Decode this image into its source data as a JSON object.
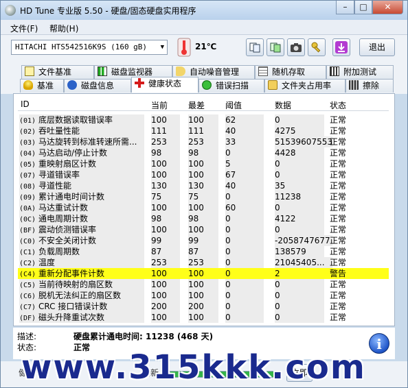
{
  "window": {
    "title": "HD Tune 专业版 5.50 - 硬盘/固态硬盘实用程序",
    "buttons": {
      "minimize": "–",
      "maximize": "□",
      "close": "✕"
    }
  },
  "menu": [
    "文件(F)",
    "帮助(H)"
  ],
  "toolbar": {
    "drive": "HITACHI HTS542516K9S (160 gB)",
    "temperature": "21℃",
    "exit_label": "退出",
    "icons": [
      "copy-text-icon",
      "copy-screen-icon",
      "camera-icon",
      "options-key-icon",
      "save-download-icon"
    ]
  },
  "tabs_top": [
    {
      "label": "文件基准",
      "icon": "benchmark-file-icon"
    },
    {
      "label": "磁盘监视器",
      "icon": "disk-monitor-icon"
    },
    {
      "label": "自动噪音管理",
      "icon": "speaker-icon"
    },
    {
      "label": "随机存取",
      "icon": "random-access-icon"
    },
    {
      "label": "附加测试",
      "icon": "extra-tests-icon"
    }
  ],
  "tabs_bottom": [
    {
      "label": "基准",
      "icon": "bulb-icon"
    },
    {
      "label": "磁盘信息",
      "icon": "info-icon"
    },
    {
      "label": "健康状态",
      "icon": "health-cross-icon",
      "active": true
    },
    {
      "label": "错误扫描",
      "icon": "error-scan-icon"
    },
    {
      "label": "文件夹占用率",
      "icon": "folder-icon"
    },
    {
      "label": "擦除",
      "icon": "trash-icon"
    }
  ],
  "table": {
    "headers": [
      "ID",
      "当前",
      "最差",
      "阈值",
      "数据",
      "状态"
    ],
    "rows": [
      {
        "id": "(01)",
        "name": "底层数据读取错误率",
        "current": "100",
        "worst": "100",
        "threshold": "62",
        "data": "0",
        "status": "正常"
      },
      {
        "id": "(02)",
        "name": "吞吐量性能",
        "current": "111",
        "worst": "111",
        "threshold": "40",
        "data": "4275",
        "status": "正常"
      },
      {
        "id": "(03)",
        "name": "马达旋转到标准转速所需...",
        "current": "253",
        "worst": "253",
        "threshold": "33",
        "data": "51539607553",
        "status": "正常"
      },
      {
        "id": "(04)",
        "name": "马达启动/停止计数",
        "current": "98",
        "worst": "98",
        "threshold": "0",
        "data": "4428",
        "status": "正常"
      },
      {
        "id": "(05)",
        "name": "重映射扇区计数",
        "current": "100",
        "worst": "100",
        "threshold": "5",
        "data": "0",
        "status": "正常"
      },
      {
        "id": "(07)",
        "name": "寻道错误率",
        "current": "100",
        "worst": "100",
        "threshold": "67",
        "data": "0",
        "status": "正常"
      },
      {
        "id": "(08)",
        "name": "寻道性能",
        "current": "130",
        "worst": "130",
        "threshold": "40",
        "data": "35",
        "status": "正常"
      },
      {
        "id": "(09)",
        "name": "累计通电时间计数",
        "current": "75",
        "worst": "75",
        "threshold": "0",
        "data": "11238",
        "status": "正常"
      },
      {
        "id": "(0A)",
        "name": "马达重试计数",
        "current": "100",
        "worst": "100",
        "threshold": "60",
        "data": "0",
        "status": "正常"
      },
      {
        "id": "(0C)",
        "name": "通电周期计数",
        "current": "98",
        "worst": "98",
        "threshold": "0",
        "data": "4122",
        "status": "正常"
      },
      {
        "id": "(BF)",
        "name": "震动侦测错误率",
        "current": "100",
        "worst": "100",
        "threshold": "0",
        "data": "0",
        "status": "正常"
      },
      {
        "id": "(C0)",
        "name": "不安全关闭计数",
        "current": "99",
        "worst": "99",
        "threshold": "0",
        "data": "-2058747677",
        "status": "正常"
      },
      {
        "id": "(C1)",
        "name": "负载周期数",
        "current": "87",
        "worst": "87",
        "threshold": "0",
        "data": "138579",
        "status": "正常"
      },
      {
        "id": "(C2)",
        "name": "温度",
        "current": "253",
        "worst": "253",
        "threshold": "0",
        "data": "21045405...",
        "status": "正常"
      },
      {
        "id": "(C4)",
        "name": "重新分配事件计数",
        "current": "100",
        "worst": "100",
        "threshold": "0",
        "data": "2",
        "status": "警告",
        "warning": true
      },
      {
        "id": "(C5)",
        "name": "当前待映射的扇区数",
        "current": "100",
        "worst": "100",
        "threshold": "0",
        "data": "0",
        "status": "正常"
      },
      {
        "id": "(C6)",
        "name": "脱机无法纠正的扇区数",
        "current": "100",
        "worst": "100",
        "threshold": "0",
        "data": "0",
        "status": "正常"
      },
      {
        "id": "(C7)",
        "name": "CRC 接口错误计数",
        "current": "200",
        "worst": "200",
        "threshold": "0",
        "data": "0",
        "status": "正常"
      },
      {
        "id": "(DF)",
        "name": "磁头升降重试次数",
        "current": "100",
        "worst": "100",
        "threshold": "0",
        "data": "0",
        "status": "正常"
      }
    ]
  },
  "info": {
    "description_label": "描述:",
    "description_value": "硬盘累计通电时间: 11238 (468 天)",
    "status_label": "状态:",
    "status_value": "正常",
    "info_button": "i"
  },
  "statusbar": {
    "left_text": "健",
    "mid_text": "刷新",
    "progress": 1.0,
    "button_text": "立即"
  },
  "watermark": "www.315kkk.com"
}
